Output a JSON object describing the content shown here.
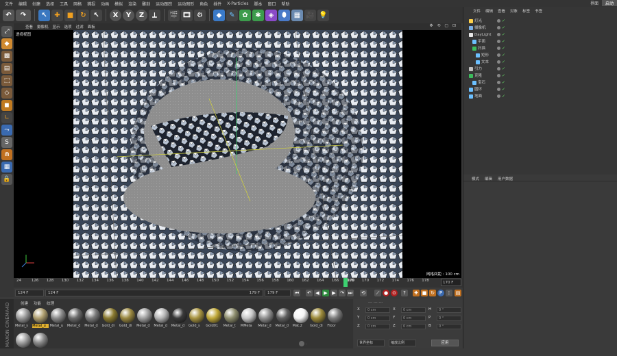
{
  "menu": {
    "items": [
      "文件",
      "编辑",
      "创建",
      "选择",
      "工具",
      "网格",
      "捕捉",
      "动画",
      "模拟",
      "渲染",
      "雕刻",
      "运动跟踪",
      "运动图形",
      "角色",
      "插件",
      "X-Particles",
      "脚本",
      "窗口",
      "帮助"
    ],
    "right": [
      "界面",
      "启动"
    ]
  },
  "viewport": {
    "menu": [
      "查看",
      "摄像机",
      "显示",
      "选项",
      "过滤",
      "面板"
    ],
    "label": "透视视图",
    "grid_label": "网格间距 : 100 cm",
    "controls": "✥ ⟲ ▢ ⊡"
  },
  "timeline": {
    "ticks": [
      "24",
      "126",
      "128",
      "130",
      "132",
      "134",
      "136",
      "138",
      "140",
      "142",
      "144",
      "146",
      "148",
      "150",
      "152",
      "154",
      "156",
      "158",
      "160",
      "162",
      "164",
      "166",
      "168",
      "170",
      "172",
      "174",
      "176",
      "178"
    ],
    "current_frame": "170",
    "frame_box": "170 F",
    "playhead_fraction": 0.8
  },
  "transport": {
    "start": "124 F",
    "start_slider": "124 F",
    "end_slider": "179 F",
    "end": "179 F"
  },
  "materials": {
    "tabs": [
      "创建",
      "功能",
      "纹理"
    ],
    "items": [
      {
        "name": "Metal_s",
        "color": "#9a9a9a"
      },
      {
        "name": "Metal_u",
        "color": "#b0a070",
        "selected": true
      },
      {
        "name": "Metal_u",
        "color": "#8c8c8c"
      },
      {
        "name": "Metal_d",
        "color": "#6a6a6a"
      },
      {
        "name": "Metal_d",
        "color": "#7a7a7a"
      },
      {
        "name": "Gold_di",
        "color": "#8a7a30"
      },
      {
        "name": "Gold_di",
        "color": "#9a8840"
      },
      {
        "name": "Metal_d",
        "color": "#a0a0a0"
      },
      {
        "name": "Metal_d",
        "color": "#b5b5b5"
      },
      {
        "name": "Metal_d",
        "color": "#3a3a3a"
      },
      {
        "name": "Gold_s",
        "color": "#a89440"
      },
      {
        "name": "Gold01",
        "color": "#c0a838"
      },
      {
        "name": "Metal_t",
        "color": "#8e8e6e"
      },
      {
        "name": "MMeta",
        "color": "#c8c8c8"
      },
      {
        "name": "Metal_d",
        "color": "#909090"
      },
      {
        "name": "Metal_d",
        "color": "#606060"
      },
      {
        "name": "Mat.2",
        "color": "#f4f4f4"
      },
      {
        "name": "Gold_di",
        "color": "#9c8a3a"
      },
      {
        "name": "Floor",
        "color": "#7c7c7c"
      }
    ],
    "row2": [
      {
        "color": "#a0a0a0"
      },
      {
        "color": "#8a8a8a"
      }
    ]
  },
  "coords": {
    "header": "--- --- ---",
    "rows": [
      {
        "a": "X",
        "av": "0 cm",
        "b": "X",
        "bv": "0 cm",
        "c": "H",
        "cv": "0 °"
      },
      {
        "a": "Y",
        "av": "0 cm",
        "b": "Y",
        "bv": "0 cm",
        "c": "P",
        "cv": "0 °"
      },
      {
        "a": "Z",
        "av": "0 cm",
        "b": "Z",
        "bv": "0 cm",
        "c": "B",
        "cv": "0 °"
      }
    ],
    "mode1": "世界坐标",
    "mode2": "缩放比例",
    "apply": "应用"
  },
  "objects": {
    "tabs": [
      "文件",
      "编辑",
      "查看",
      "对象",
      "标签",
      "书签"
    ],
    "rows": [
      {
        "name": "灯光",
        "icon": "#ffd24a",
        "indent": 0
      },
      {
        "name": "摄像机",
        "icon": "#7ab0e8",
        "indent": 0
      },
      {
        "name": "DayLight",
        "icon": "#e8e8e8",
        "indent": 0
      },
      {
        "name": "平面",
        "icon": "#6cc0ff",
        "indent": 1
      },
      {
        "name": "扫描",
        "icon": "#3cbc5c",
        "indent": 1
      },
      {
        "name": "矩形",
        "icon": "#6cc0ff",
        "indent": 2
      },
      {
        "name": "文本",
        "icon": "#6cc0ff",
        "indent": 2
      },
      {
        "name": "引力",
        "icon": "#c0c0c0",
        "indent": 0
      },
      {
        "name": "克隆",
        "icon": "#3cbc5c",
        "indent": 0
      },
      {
        "name": "宝石",
        "icon": "#6cc0ff",
        "indent": 1
      },
      {
        "name": "圆环",
        "icon": "#6cc0ff",
        "indent": 0
      },
      {
        "name": "地面",
        "icon": "#6cc0ff",
        "indent": 0
      }
    ]
  },
  "attributes": {
    "tabs": [
      "模式",
      "编辑",
      "用户数据"
    ]
  },
  "logo": "MAXON CINEMA4D"
}
